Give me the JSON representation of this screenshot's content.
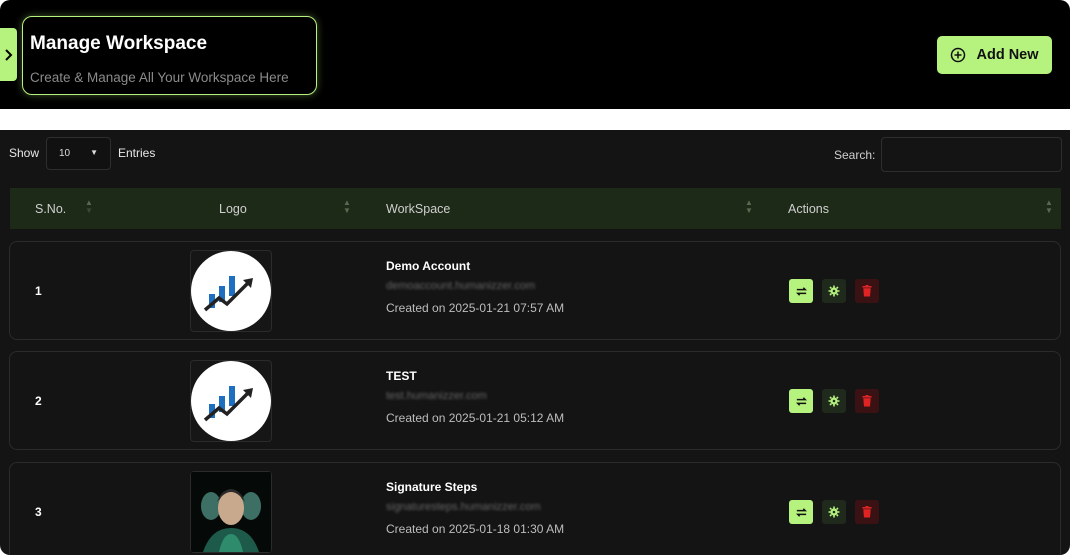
{
  "header": {
    "title": "Manage Workspace",
    "subtitle": "Create & Manage All Your Workspace Here",
    "add_button_label": "Add New"
  },
  "table_controls": {
    "show_label": "Show",
    "entries_value": "10",
    "entries_label": "Entries",
    "search_label": "Search:"
  },
  "columns": [
    "S.No.",
    "Logo",
    "WorkSpace",
    "Actions"
  ],
  "rows": [
    {
      "sno": "1",
      "name": "Demo Account",
      "domain": "demoaccount.humanizzer.com",
      "created": "Created on 2025-01-21 07:57 AM",
      "logo": "chart-growth-logo"
    },
    {
      "sno": "2",
      "name": "TEST",
      "domain": "test.humanizzer.com",
      "created": "Created on 2025-01-21 05:12 AM",
      "logo": "chart-growth-logo"
    },
    {
      "sno": "3",
      "name": "Signature Steps",
      "domain": "signaturesteps.humanizzer.com",
      "created": "Created on 2025-01-18 01:30 AM",
      "logo": "faces-logo"
    }
  ],
  "colors": {
    "accent": "#b6f37e",
    "header_bg": "#000000",
    "panel_bg": "#141414",
    "delete": "#e02424"
  },
  "icons": [
    "chevron-right-icon",
    "plus-circle-icon",
    "refresh-icon",
    "gear-icon",
    "trash-icon",
    "sort-icon"
  ]
}
